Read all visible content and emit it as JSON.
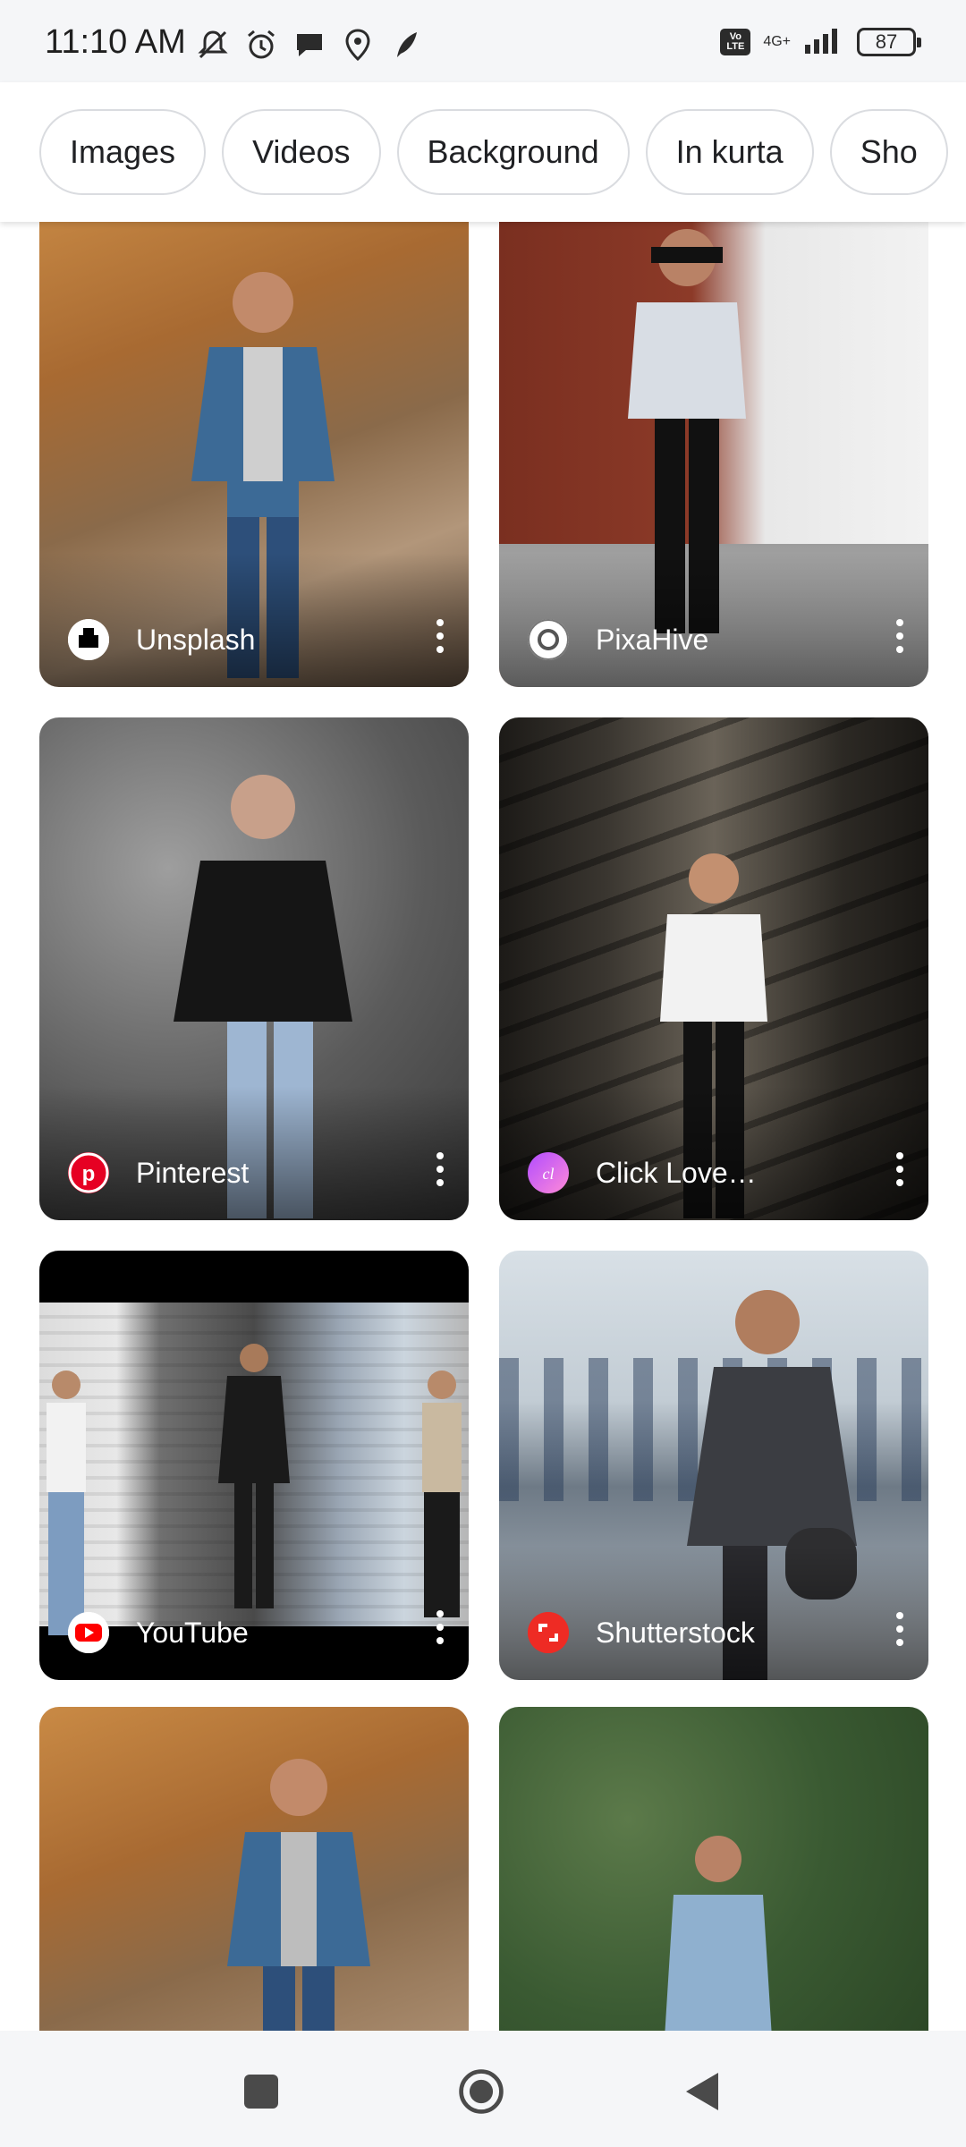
{
  "status_bar": {
    "time": "11:10 AM",
    "volte": "Vo LTE",
    "network": "4G+",
    "battery": "87"
  },
  "chips": [
    "Images",
    "Videos",
    "Background",
    "In kurta",
    "Sho"
  ],
  "results": [
    {
      "source": "Unsplash",
      "favicon": "unsplash-icon"
    },
    {
      "source": "PixaHive",
      "favicon": "pixahive-icon"
    },
    {
      "source": "Pinterest",
      "favicon": "pinterest-icon"
    },
    {
      "source": "Click Love…",
      "favicon": "clicklove-icon"
    },
    {
      "source": "YouTube",
      "favicon": "youtube-icon"
    },
    {
      "source": "Shutterstock",
      "favicon": "shutterstock-icon"
    }
  ],
  "nav": {
    "recents": "square-icon",
    "home": "circle-icon",
    "back": "triangle-back-icon"
  }
}
